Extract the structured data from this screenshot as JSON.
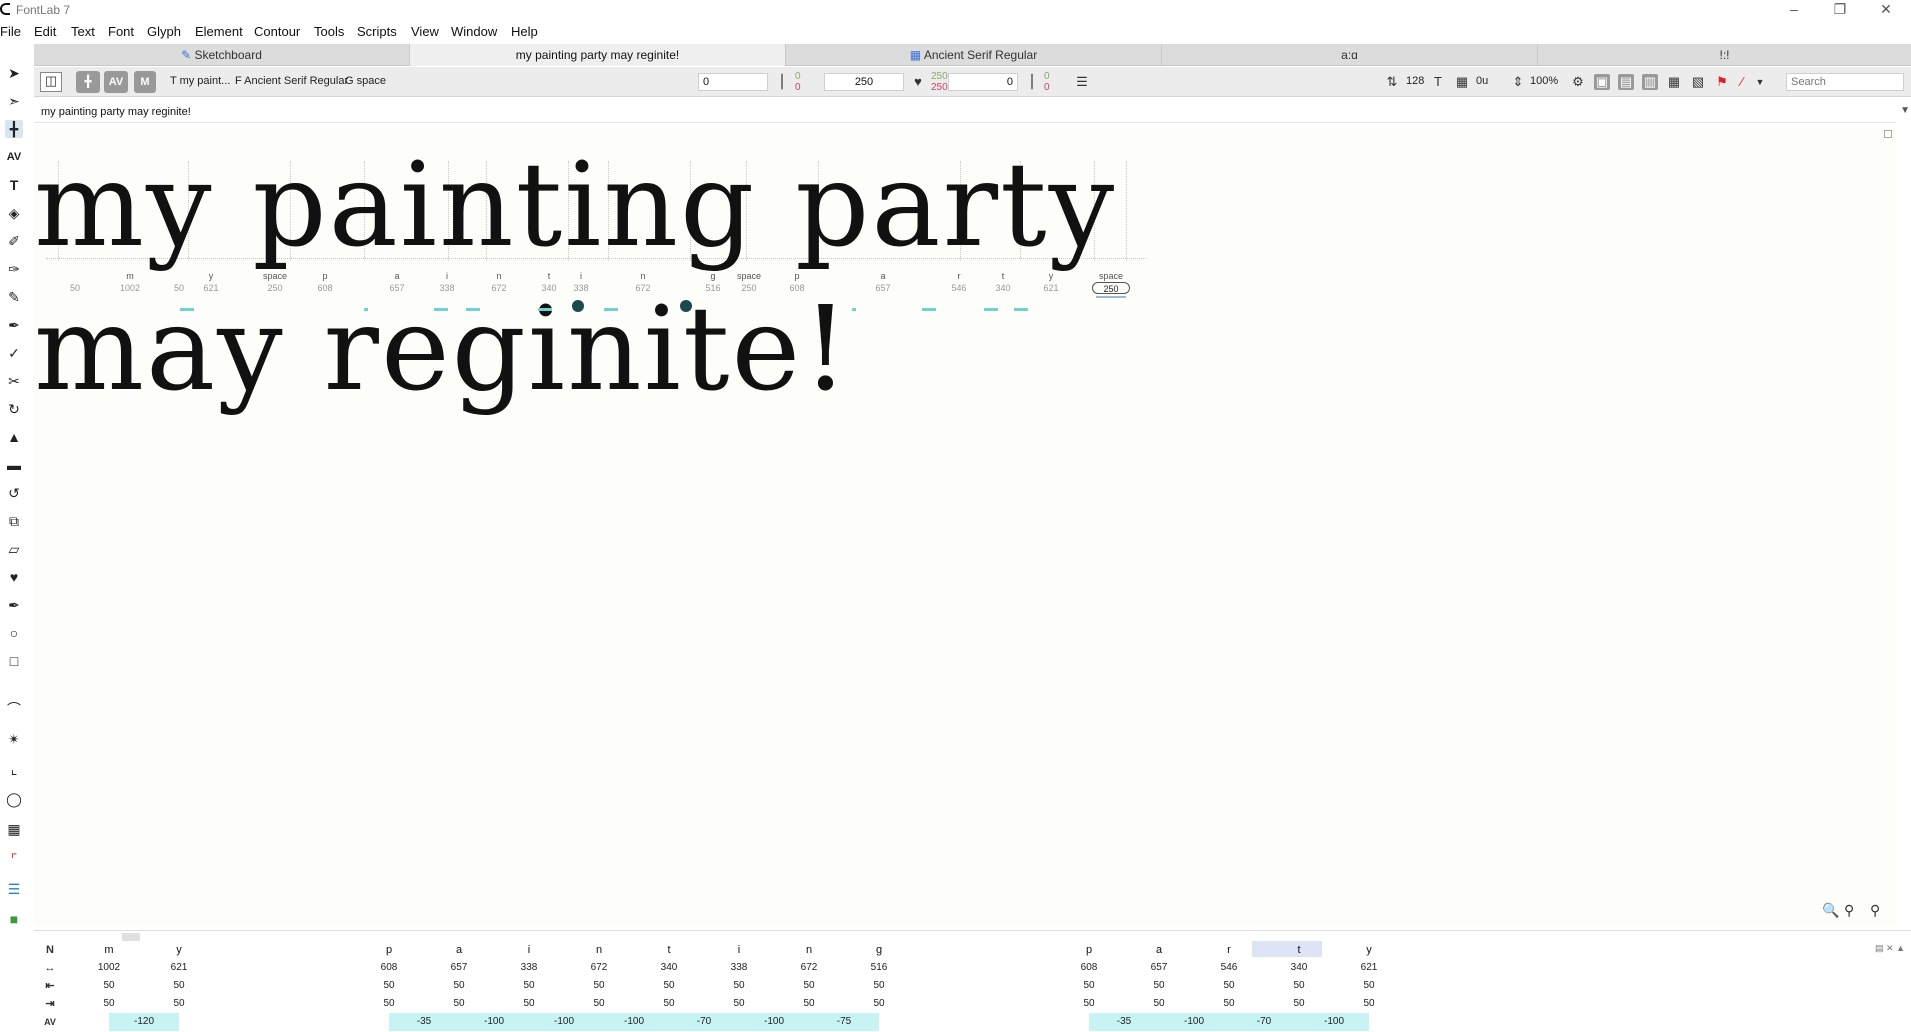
{
  "window": {
    "title": "FontLab 7"
  },
  "menu": [
    "File",
    "Edit",
    "Text",
    "Font",
    "Glyph",
    "Element",
    "Contour",
    "Tools",
    "Scripts",
    "View",
    "Window",
    "Help"
  ],
  "tabs": [
    {
      "label": "Sketchboard",
      "icon": "pencil-icon"
    },
    {
      "label": "my painting party  may reginite!",
      "active": true
    },
    {
      "label": "Ancient Serif Regular",
      "icon": "grid-icon"
    },
    {
      "label": "a:ɑ"
    },
    {
      "label": "!:!"
    }
  ],
  "toolbar": {
    "text_label": "T my paint...",
    "font_label": "F Ancient Serif Regular",
    "glyph_label": "G space",
    "lsb_value": "0",
    "lsb_small": [
      "0",
      "0"
    ],
    "width_value": "250",
    "width_small": [
      "250",
      "250"
    ],
    "rsb_value": "0",
    "rsb_small": [
      "0",
      "0"
    ],
    "font_size": "128",
    "units": "0u",
    "zoom": "100%",
    "search_placeholder": "Search"
  },
  "text_bar": {
    "value": "my painting party  may reginite!"
  },
  "canvas": {
    "line1": "my painting party",
    "line2": "may reginite!",
    "metrics": [
      {
        "name": "",
        "value": "50"
      },
      {
        "name": "m",
        "value": "1002"
      },
      {
        "name": "",
        "value": "50"
      },
      {
        "name": "y",
        "value": "621"
      },
      {
        "name": "space",
        "value": "250"
      },
      {
        "name": "p",
        "value": "608"
      },
      {
        "name": "a",
        "value": "657"
      },
      {
        "name": "i",
        "value": "338"
      },
      {
        "name": "n",
        "value": "672"
      },
      {
        "name": "t",
        "value": "340"
      },
      {
        "name": "i",
        "value": "338"
      },
      {
        "name": "n",
        "value": "672"
      },
      {
        "name": "g",
        "value": "516"
      },
      {
        "name": "space",
        "value": "250"
      },
      {
        "name": "p",
        "value": "608"
      },
      {
        "name": "a",
        "value": "657"
      },
      {
        "name": "r",
        "value": "546"
      },
      {
        "name": "t",
        "value": "340"
      },
      {
        "name": "y",
        "value": "621"
      },
      {
        "name": "space",
        "value": "250",
        "selected": true
      }
    ]
  },
  "bottom_panel": {
    "header_label": "N",
    "glyphs": [
      "m",
      "y",
      "",
      "",
      "p",
      "a",
      "i",
      "n",
      "t",
      "i",
      "n",
      "g",
      "",
      "",
      "p",
      "a",
      "r",
      "t",
      "y"
    ],
    "widths": [
      "1002",
      "621",
      "",
      "",
      "608",
      "657",
      "338",
      "672",
      "340",
      "338",
      "672",
      "516",
      "",
      "",
      "608",
      "657",
      "546",
      "340",
      "621"
    ],
    "lsb": [
      "50",
      "50",
      "",
      "",
      "50",
      "50",
      "50",
      "50",
      "50",
      "50",
      "50",
      "50",
      "",
      "",
      "50",
      "50",
      "50",
      "50",
      "50"
    ],
    "rsb": [
      "50",
      "50",
      "",
      "",
      "50",
      "50",
      "50",
      "50",
      "50",
      "50",
      "50",
      "50",
      "",
      "",
      "50",
      "50",
      "50",
      "50",
      "50"
    ],
    "kerning": [
      "-120",
      "",
      "",
      "",
      "-35",
      "-100",
      "-100",
      "-100",
      "-70",
      "-100",
      "-75",
      "",
      "",
      "",
      "-35",
      "-100",
      "-70",
      "-100",
      ""
    ]
  },
  "colors": {
    "kern_highlight": "#c8f3f3",
    "kern_mark": "#6fd4d0",
    "canvas_bg": "#fdfdf9"
  }
}
